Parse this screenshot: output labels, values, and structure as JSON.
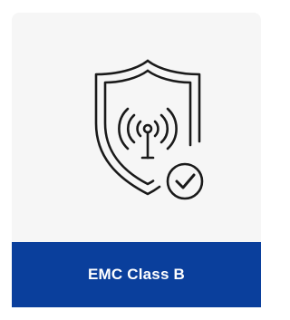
{
  "card": {
    "label": "EMC Class B",
    "icon": "shield-antenna-check-icon",
    "colors": {
      "card_background": "#f6f6f6",
      "footer_background": "#0a3f9c",
      "footer_text": "#ffffff",
      "icon_stroke": "#1a1a1a"
    }
  }
}
